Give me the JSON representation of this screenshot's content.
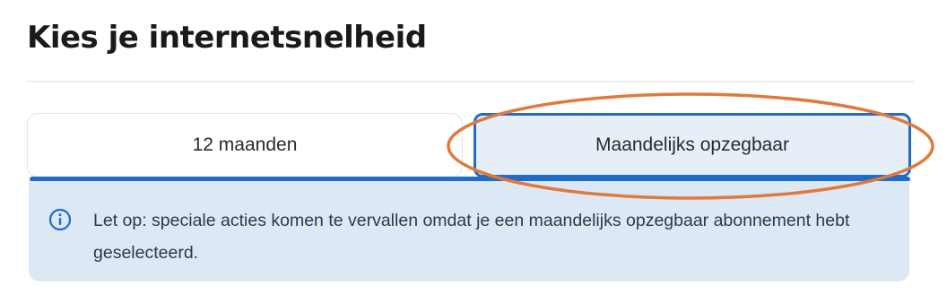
{
  "page": {
    "title": "Kies je internetsnelheid"
  },
  "contract_toggle": {
    "options": [
      {
        "label": "12 maanden",
        "selected": false
      },
      {
        "label": "Maandelijks opzegbaar",
        "selected": true
      }
    ]
  },
  "notice": {
    "icon": "info-icon",
    "text": "Let op: speciale acties komen te vervallen omdat je een maandelijks opzegbaar abonnement hebt geselecteerd."
  },
  "colors": {
    "accent": "#1f6cc9",
    "selected_bg": "#e6eef8",
    "notice_bg": "#dde8f5",
    "annotation": "#e07a3c"
  }
}
